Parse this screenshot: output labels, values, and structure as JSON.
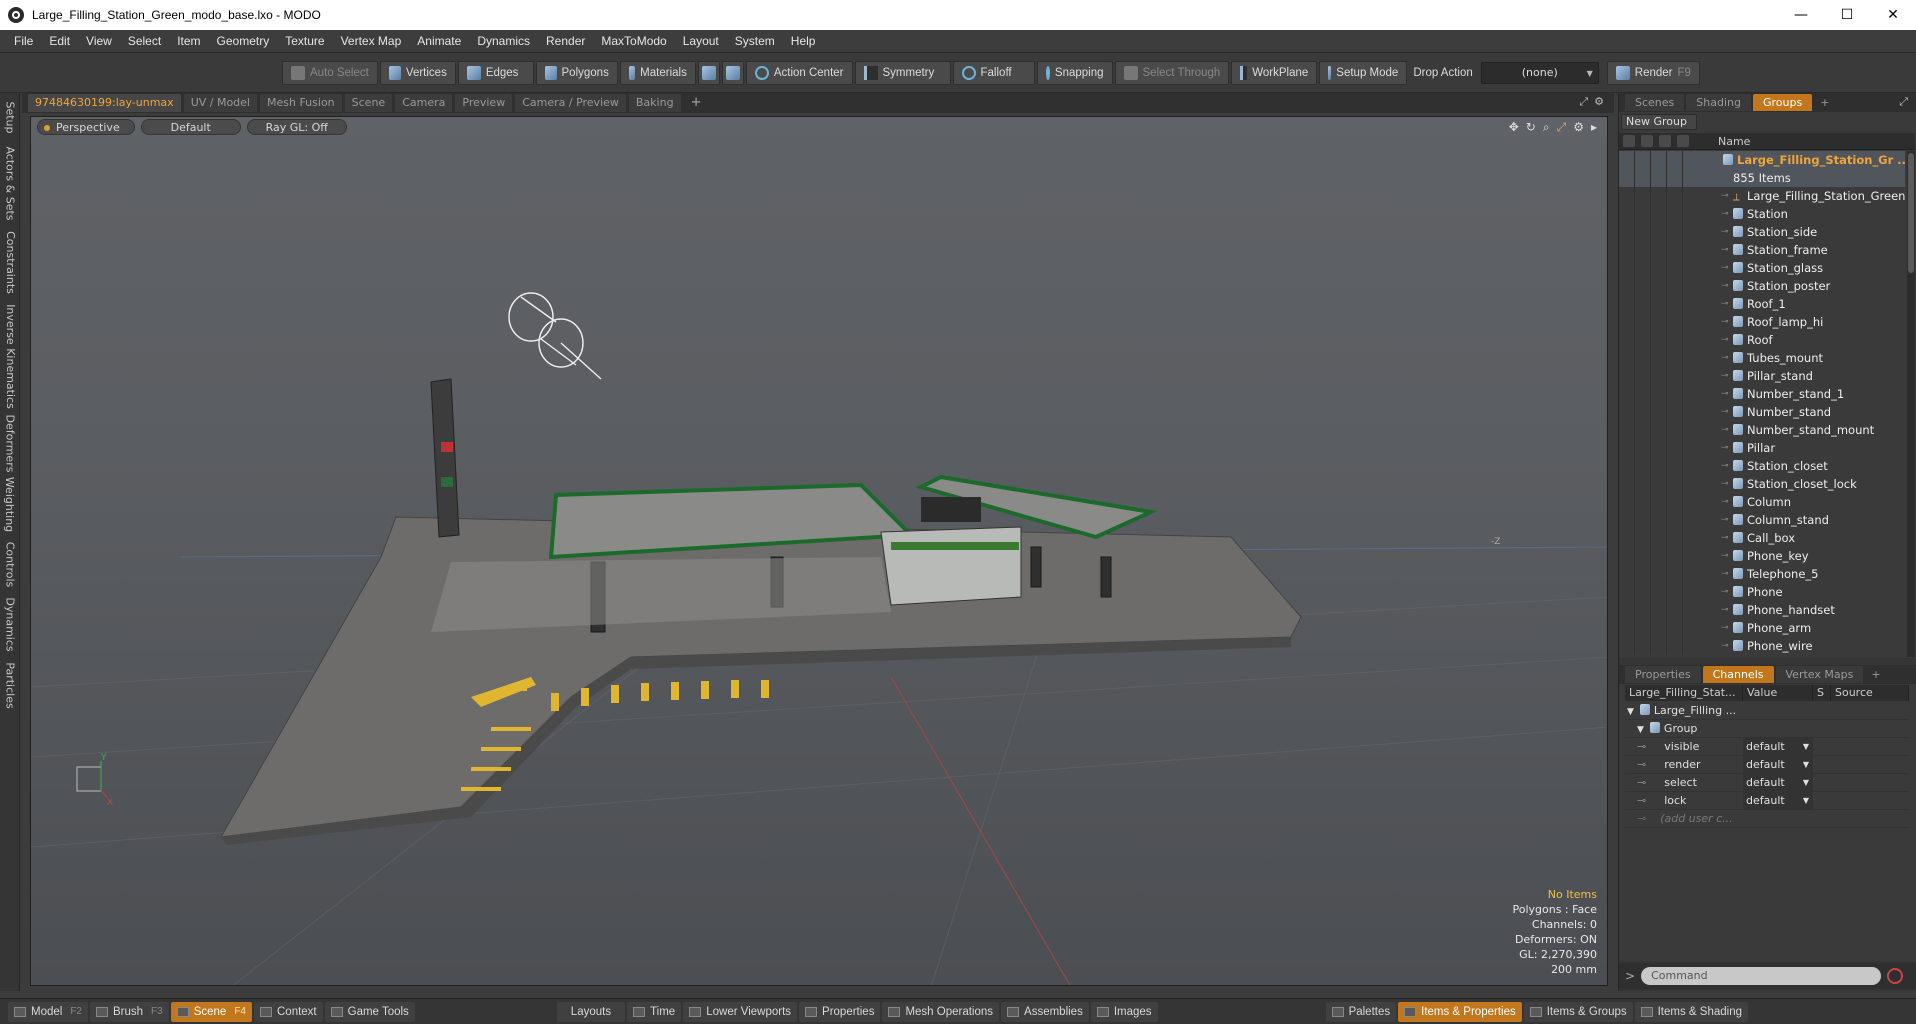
{
  "window": {
    "title": "Large_Filling_Station_Green_modo_base.lxo - MODO",
    "min": "—",
    "max": "☐",
    "close": "✕"
  },
  "menu": [
    "File",
    "Edit",
    "View",
    "Select",
    "Item",
    "Geometry",
    "Texture",
    "Vertex Map",
    "Animate",
    "Dynamics",
    "Render",
    "MaxToModo",
    "Layout",
    "System",
    "Help"
  ],
  "toolbar": {
    "auto_select": "Auto Select",
    "vertices": "Vertices",
    "edges": "Edges",
    "polygons": "Polygons",
    "materials": "Materials",
    "action_center": "Action Center",
    "symmetry": "Symmetry",
    "falloff": "Falloff",
    "snapping": "Snapping",
    "select_through": "Select Through",
    "workplane": "WorkPlane",
    "setup_mode": "Setup Mode",
    "drop_action_label": "Drop Action",
    "drop_action_value": "(none)",
    "render": "Render",
    "render_key": "F9"
  },
  "left_tabs": [
    "Setup",
    "Actors & Sets",
    "Constraints",
    "Inverse Kinematics",
    "Deformers",
    "Weighting",
    "Controls",
    "Dynamics",
    "Particles"
  ],
  "viewport_tabs": [
    "97484630199:lay-unmax",
    "UV / Model",
    "Mesh Fusion",
    "Scene",
    "Camera",
    "Preview",
    "Camera / Preview",
    "Baking",
    "+"
  ],
  "viewport": {
    "projection": "Perspective",
    "shading": "Default",
    "raygl": "Ray GL: Off",
    "info": {
      "selection": "No Items",
      "polygons": "Polygons : Face",
      "channels": "Channels: 0",
      "deformers": "Deformers: ON",
      "gl": "GL: 2,270,390",
      "grid": "200 mm"
    },
    "axis": {
      "x": "X",
      "y": "Y",
      "z": "-Z"
    }
  },
  "right_tabs": [
    "Scenes",
    "Shading",
    "Groups",
    "+"
  ],
  "groups": {
    "new_group": "New Group",
    "name_header": "Name",
    "group_name": "Large_Filling_Station_Gr ...",
    "item_count": "855 Items",
    "items": [
      "Large_Filling_Station_Green",
      "Station",
      "Station_side",
      "Station_frame",
      "Station_glass",
      "Station_poster",
      "Roof_1",
      "Roof_lamp_hi",
      "Roof",
      "Tubes_mount",
      "Pillar_stand",
      "Number_stand_1",
      "Number_stand",
      "Number_stand_mount",
      "Pillar",
      "Station_closet",
      "Station_closet_lock",
      "Column",
      "Column_stand",
      "Call_box",
      "Phone_key",
      "Telephone_5",
      "Phone",
      "Phone_handset",
      "Phone_arm",
      "Phone_wire"
    ]
  },
  "lower_tabs": [
    "Properties",
    "Channels",
    "Vertex Maps",
    "+"
  ],
  "channels": {
    "headers": [
      "Large_Filling_Stat...",
      "Value",
      "S",
      "Source"
    ],
    "root": "Large_Filling ...",
    "group": "Group",
    "rows": [
      {
        "name": "visible",
        "value": "default"
      },
      {
        "name": "render",
        "value": "default"
      },
      {
        "name": "select",
        "value": "default"
      },
      {
        "name": "lock",
        "value": "default"
      }
    ],
    "add_user": "(add user c..."
  },
  "command": {
    "prompt": ">",
    "placeholder": "Command"
  },
  "bottom_left": [
    {
      "label": "Model",
      "key": "F2"
    },
    {
      "label": "Brush",
      "key": "F3"
    },
    {
      "label": "Scene",
      "key": "F4"
    },
    {
      "label": "Context",
      "key": ""
    },
    {
      "label": "Game Tools",
      "key": ""
    }
  ],
  "bottom_mid": [
    "Layouts",
    "Time",
    "Lower Viewports",
    "Properties",
    "Mesh Operations",
    "Assemblies",
    "Images"
  ],
  "bottom_right": [
    "Palettes",
    "Items & Properties",
    "Items & Groups",
    "Items & Shading"
  ]
}
